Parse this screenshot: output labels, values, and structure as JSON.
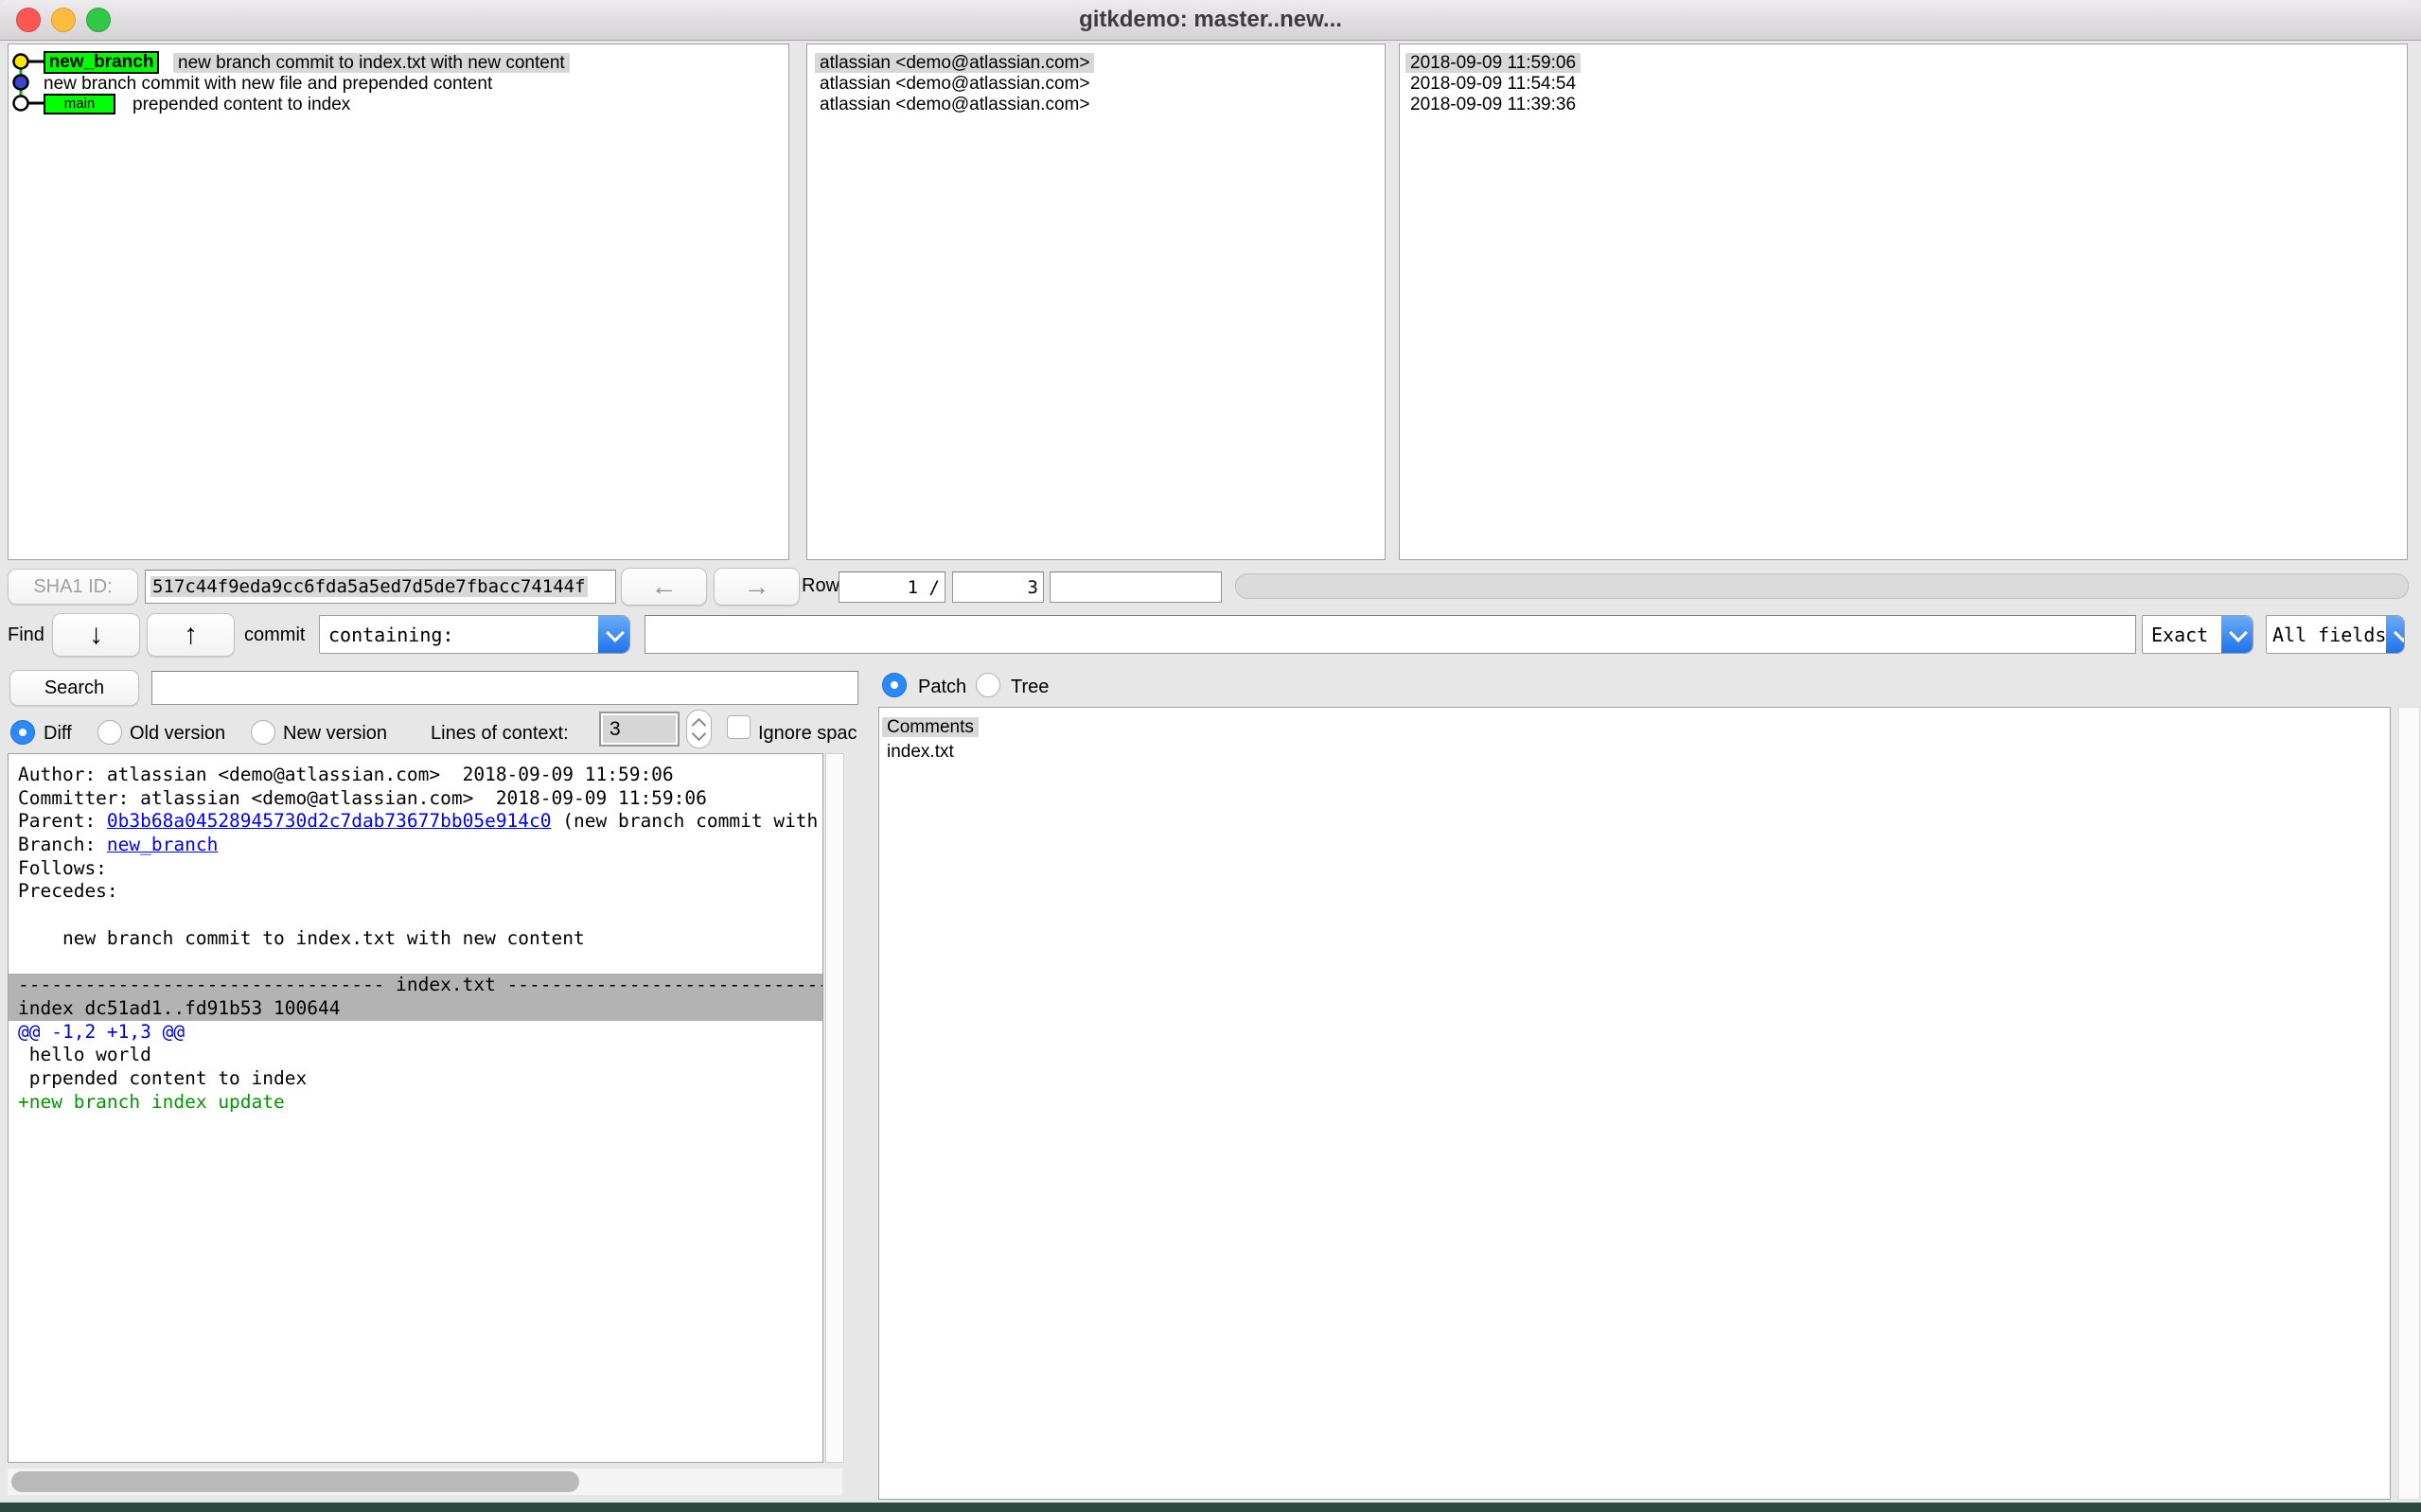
{
  "window": {
    "title": "gitkdemo: master..new..."
  },
  "colors": {
    "accent_blue": "#2e89f8",
    "branch_label_green": "#00ff00",
    "selection_gray": "#d8d8d8",
    "link_blue": "#0000ff",
    "diff_hunk_blue": "#0000e8",
    "diff_add_green": "#009800",
    "file_header_gray": "#b3b3b3",
    "desktop_strip": "#2e4a40"
  },
  "node_colors": {
    "yellow": "#ffe800",
    "blue": "#3944d0",
    "white": "#ffffff",
    "line_green": "#00b400"
  },
  "commits": {
    "rows": [
      {
        "node": "yellow-circle",
        "branch_label": "new_branch",
        "message": "new branch commit to index.txt with new content",
        "author": "atlassian <demo@atlassian.com>",
        "date": "2018-09-09 11:59:06",
        "selected": true
      },
      {
        "node": "blue-circle",
        "message": "new branch commit with new file and prepended content",
        "author": "atlassian <demo@atlassian.com>",
        "date": "2018-09-09 11:54:54",
        "selected": false
      },
      {
        "node": "white-circle",
        "branch_label": "main",
        "message": "prepended content to index",
        "author": "atlassian <demo@atlassian.com>",
        "date": "2018-09-09 11:39:36",
        "selected": false
      }
    ]
  },
  "sha_bar": {
    "button_label": "SHA1 ID:",
    "sha_value": "517c44f9eda9cc6fda5a5ed7d5de7fbacc74144f",
    "row_label": "Row",
    "row_current": "1 /",
    "row_total": "3"
  },
  "find_bar": {
    "find_label": "Find",
    "commit_label": "commit",
    "match_type": "containing:",
    "query": "",
    "match_mode": "Exact",
    "fields": "All fields"
  },
  "search_bar": {
    "button_label": "Search",
    "query": ""
  },
  "view_mode": {
    "patch_label": "Patch",
    "tree_label": "Tree"
  },
  "diff_mode": {
    "diff_label": "Diff",
    "old_label": "Old version",
    "new_label": "New version",
    "context_label": "Lines of context:",
    "context_value": "3",
    "ignore_label": "Ignore spac"
  },
  "file_list": {
    "items": [
      "Comments",
      "index.txt"
    ]
  },
  "diff": {
    "lines": [
      {
        "text": "Author: atlassian <demo@atlassian.com>  2018-09-09 11:59:06"
      },
      {
        "text": "Committer: atlassian <demo@atlassian.com>  2018-09-09 11:59:06"
      },
      {
        "prefix": "Parent: ",
        "link": "0b3b68a04528945730d2c7dab73677bb05e914c0",
        "suffix": " (new branch commit with"
      },
      {
        "prefix": "Branch: ",
        "link": "new_branch",
        "suffix": ""
      },
      {
        "text": "Follows: "
      },
      {
        "text": "Precedes: "
      },
      {
        "text": ""
      },
      {
        "text": "    new branch commit to index.txt with new content"
      },
      {
        "text": ""
      },
      {
        "text": "--------------------------------- index.txt ---------------------------------------------"
      },
      {
        "text": "index dc51ad1..fd91b53 100644"
      },
      {
        "text": "@@ -1,2 +1,3 @@"
      },
      {
        "text": " hello world"
      },
      {
        "text": " prpended content to index"
      },
      {
        "text": "+new branch index update"
      }
    ]
  }
}
